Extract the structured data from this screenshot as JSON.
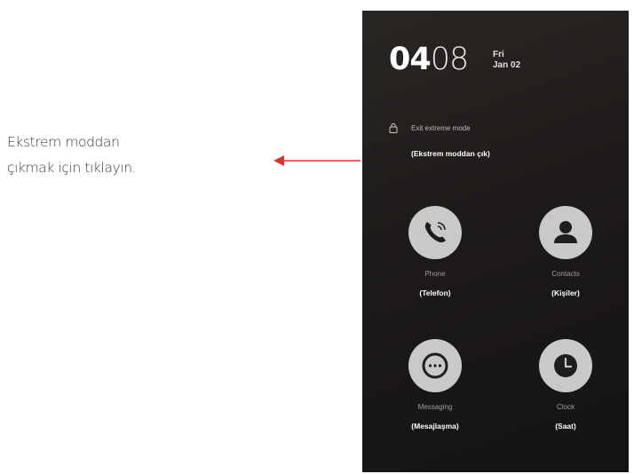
{
  "annotation": {
    "line1": "Ekstrem moddan",
    "line2": "çıkmak için tıklayın."
  },
  "lockscreen": {
    "time_hours": "04",
    "time_minutes": "08",
    "day": "Fri",
    "date": "Jan 02",
    "exit_mode_title": "Exit extreme mode",
    "exit_mode_sub": "(Ekstrem moddan çık)"
  },
  "apps": [
    {
      "label": "Phone",
      "sub": "(Telefon)",
      "icon": "phone-icon"
    },
    {
      "label": "Contacts",
      "sub": "(Kişiler)",
      "icon": "contacts-icon"
    },
    {
      "label": "Messaging",
      "sub": "(Mesajlaşma)",
      "icon": "messaging-icon"
    },
    {
      "label": "Clock",
      "sub": "(Saat)",
      "icon": "clock-icon"
    }
  ],
  "colors": {
    "arrow": "#e03030",
    "icon_circle": "#c9c9c9",
    "screen_bg": "#1d1a19"
  }
}
